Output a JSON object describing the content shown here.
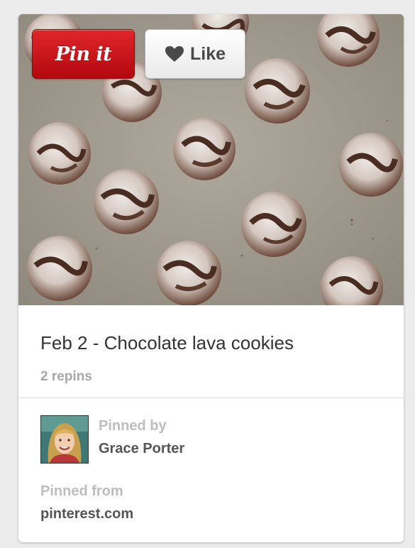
{
  "pin": {
    "photo_icon": "chocolate-cookies-photo",
    "pin_it_label": "Pin it",
    "like_label": "Like",
    "like_icon": "heart-icon",
    "title": "Feb 2 - Chocolate lava cookies",
    "repins": "2 repins"
  },
  "pinner": {
    "label": "Pinned by",
    "name": "Grace Porter",
    "avatar_icon": "user-avatar"
  },
  "source": {
    "label": "Pinned from",
    "domain": "pinterest.com"
  },
  "colors": {
    "pin_button": "#cb1a21",
    "background": "#ececec",
    "title_text": "#333333",
    "muted_text": "#a7a7a7"
  }
}
